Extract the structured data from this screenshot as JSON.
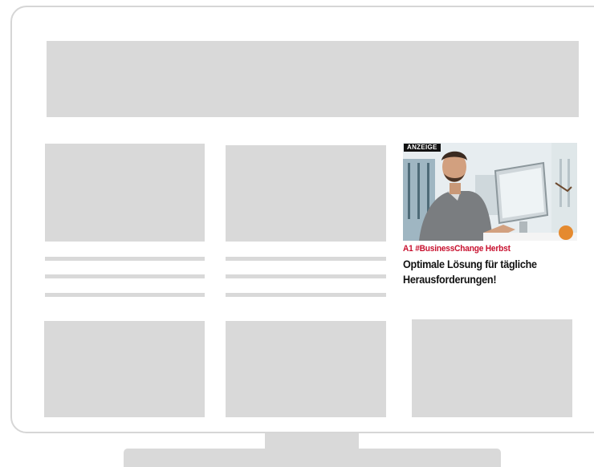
{
  "ad": {
    "badge": "ANZEIGE",
    "kicker": "A1 #BusinessChange Herbst",
    "title": "Optimale Lösung für tägliche Herausforderungen!"
  },
  "colors": {
    "placeholder": "#d9d9d9",
    "frame": "#d6d6d6",
    "kicker": "#c8102e",
    "title": "#111111"
  }
}
